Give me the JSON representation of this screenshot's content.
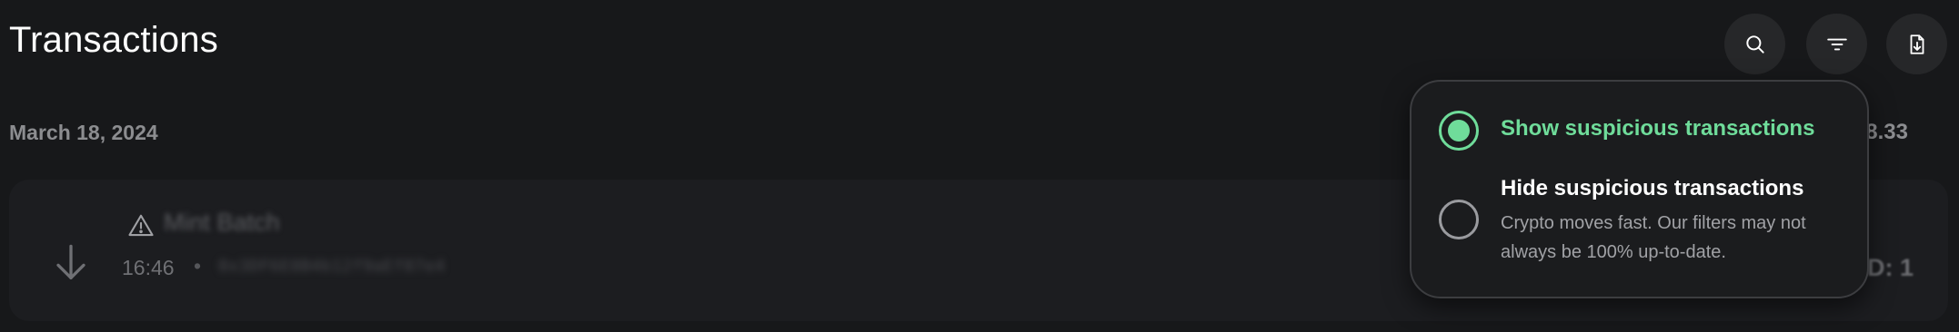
{
  "header": {
    "title": "Transactions",
    "actions": [
      {
        "name": "search",
        "icon": "search-icon"
      },
      {
        "name": "filter",
        "icon": "filter-icon"
      },
      {
        "name": "export",
        "icon": "file-download-icon"
      }
    ]
  },
  "groups": [
    {
      "date": "March 18, 2024",
      "total_partial": "8.33",
      "transactions": [
        {
          "direction_icon": "arrow-down-icon",
          "warning_icon": "warning-triangle-icon",
          "name": "Mint Batch",
          "time": "16:46",
          "separator": "•",
          "address": "0x3DF6E8B4b12f9aEf87e4",
          "amount_partial": "D: 1"
        }
      ]
    }
  ],
  "filter_popover": {
    "options": [
      {
        "label": "Show suspicious transactions",
        "description": "",
        "selected": true
      },
      {
        "label": "Hide suspicious transactions",
        "description": "Crypto moves fast. Our filters may not always be 100% up-to-date.",
        "selected": false
      }
    ]
  },
  "colors": {
    "background": "#17181a",
    "card": "#1c1d20",
    "accent_green": "#6fdc9a",
    "muted_text": "#8c8d90"
  }
}
